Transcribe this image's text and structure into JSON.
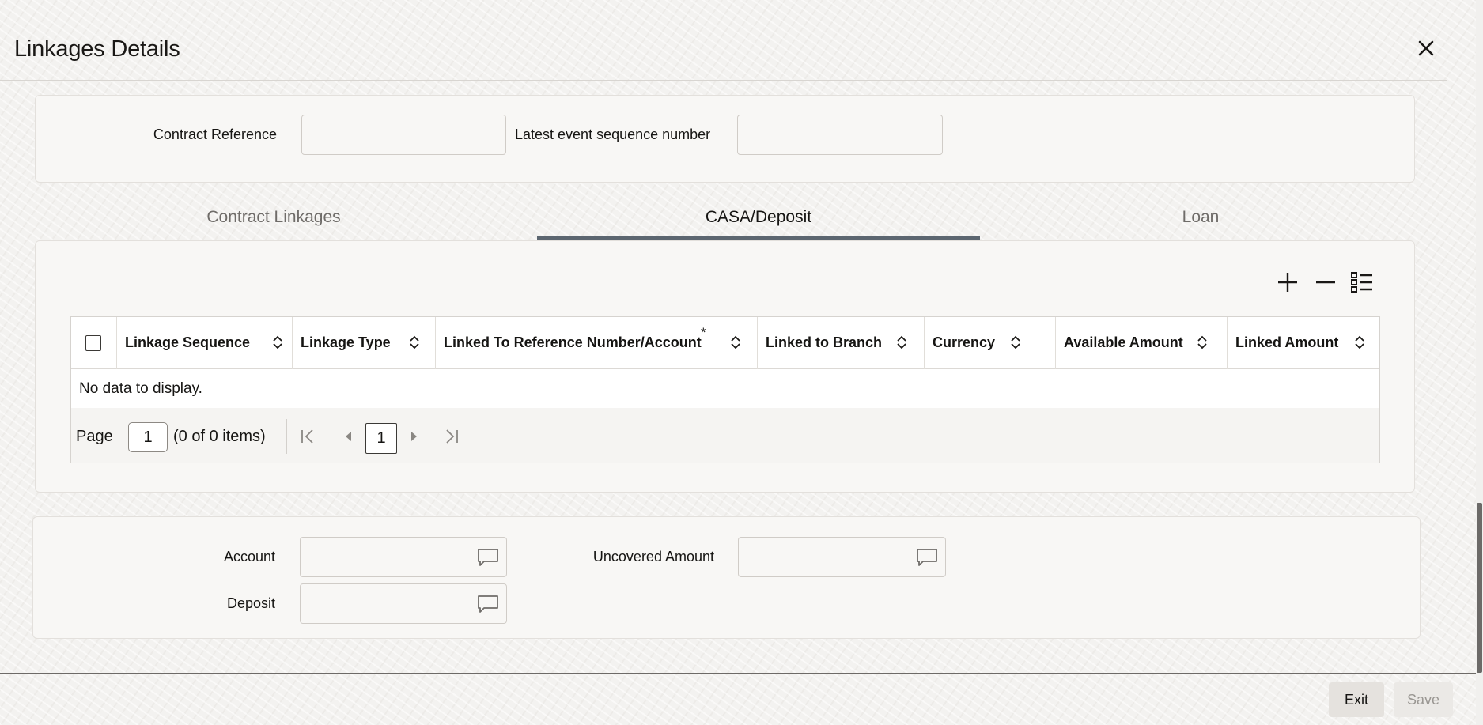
{
  "dialog": {
    "title": "Linkages Details"
  },
  "header_fields": {
    "contract_reference_label": "Contract Reference",
    "contract_reference_value": "",
    "latest_event_seq_label": "Latest event sequence number",
    "latest_event_seq_value": ""
  },
  "tabs": [
    {
      "label": "Contract Linkages",
      "active": false
    },
    {
      "label": "CASA/Deposit",
      "active": true
    },
    {
      "label": "Loan",
      "active": false
    }
  ],
  "grid": {
    "columns": [
      "Linkage Sequence",
      "Linkage Type",
      "Linked To Reference Number/Account",
      "Linked to Branch",
      "Currency",
      "Available Amount",
      "Linked Amount"
    ],
    "required_marker": "*",
    "empty_message": "No data to display.",
    "pager": {
      "page_label": "Page",
      "page_input": "1",
      "items_text": "(0 of 0 items)",
      "current_page": "1"
    }
  },
  "bottom_fields": {
    "account_label": "Account",
    "account_value": "",
    "uncovered_amount_label": "Uncovered Amount",
    "uncovered_amount_value": "",
    "deposit_label": "Deposit",
    "deposit_value": ""
  },
  "footer": {
    "exit_label": "Exit",
    "save_label": "Save"
  },
  "icons": {
    "close": "close-icon",
    "add": "plus-icon",
    "remove": "minus-icon",
    "columns": "list-icon",
    "sort": "sort-icon",
    "lov": "speech-bubble-icon"
  },
  "colors": {
    "tab_underline": "#5c6670",
    "text": "#161513",
    "inactive_tab": "#6f6c69"
  }
}
